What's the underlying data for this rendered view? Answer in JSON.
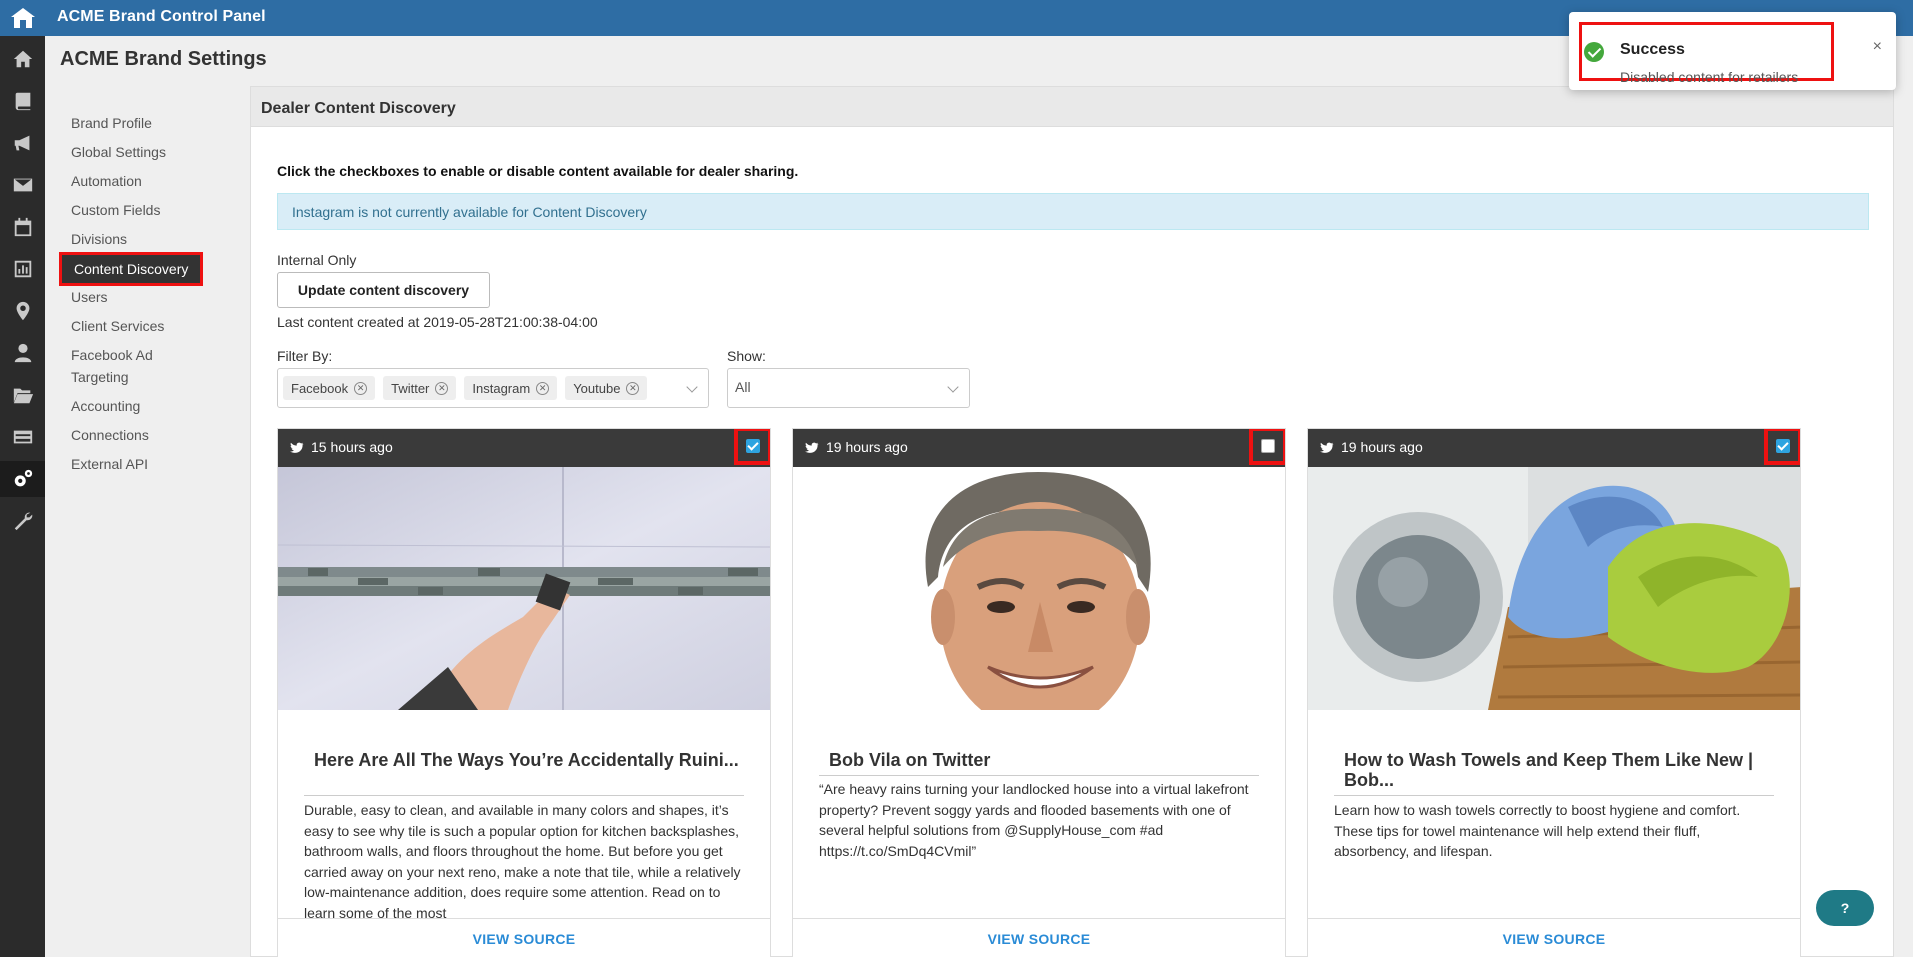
{
  "app": {
    "title": "ACME Brand Control Panel"
  },
  "page": {
    "title": "ACME Brand Settings"
  },
  "sidenav": {
    "items": [
      {
        "label": "Brand Profile"
      },
      {
        "label": "Global Settings"
      },
      {
        "label": "Automation"
      },
      {
        "label": "Custom Fields"
      },
      {
        "label": "Divisions"
      },
      {
        "label": "Content Discovery",
        "active": true
      },
      {
        "label": "Users"
      },
      {
        "label": "Client Services"
      },
      {
        "label": "Facebook Ad Targeting"
      },
      {
        "label": "Accounting"
      },
      {
        "label": "Connections"
      },
      {
        "label": "External API"
      }
    ]
  },
  "rail": {
    "icons": [
      "home-icon",
      "book-icon",
      "megaphone-icon",
      "envelope-icon",
      "calendar-icon",
      "bar-chart-icon",
      "map-pin-icon",
      "user-icon",
      "folder-icon",
      "credit-card-icon",
      "gears-icon",
      "wrench-icon"
    ],
    "active": "gears-icon"
  },
  "panel": {
    "title": "Dealer Content Discovery",
    "instructions": "Click the checkboxes to enable or disable content available for dealer sharing.",
    "alert": "Instagram is not currently available for Content Discovery",
    "internal_label": "Internal Only",
    "update_button": "Update content discovery",
    "last_created": "Last content created at 2019-05-28T21:00:38-04:00",
    "filter_label": "Filter By:",
    "filters": [
      {
        "label": "Facebook"
      },
      {
        "label": "Twitter"
      },
      {
        "label": "Instagram"
      },
      {
        "label": "Youtube"
      }
    ],
    "show_label": "Show:",
    "show_value": "All"
  },
  "cards": [
    {
      "time": "15 hours ago",
      "checked": true,
      "title": "Here Are All The Ways You’re Accidentally Ruini...",
      "text": "Durable, easy to clean, and available in many colors and shapes, it’s easy to see why tile is such a popular option for kitchen backsplashes, bathroom walls, and floors throughout the home. But before you get carried away on your next reno, make a note that tile, while a relatively low-maintenance addition, does require some attention. Read on to learn some of the most",
      "link": "VIEW SOURCE"
    },
    {
      "time": "19 hours ago",
      "checked": false,
      "title": "Bob Vila on Twitter",
      "text": "“Are heavy rains turning your landlocked house into a virtual lakefront property? Prevent soggy yards and flooded basements with one of several helpful solutions from @SupplyHouse_com #ad https://t.co/SmDq4CVmil”",
      "link": "VIEW SOURCE"
    },
    {
      "time": "19 hours ago",
      "checked": true,
      "title": "How to Wash Towels and Keep Them Like New | Bob...",
      "text": "Learn how to wash towels correctly to boost hygiene and comfort. These tips for towel maintenance will help extend their fluff, absorbency, and lifespan.",
      "link": "VIEW SOURCE"
    }
  ],
  "toast": {
    "title": "Success",
    "message": "Disabled content for retailers",
    "close": "×"
  },
  "help": {
    "label": "?"
  }
}
